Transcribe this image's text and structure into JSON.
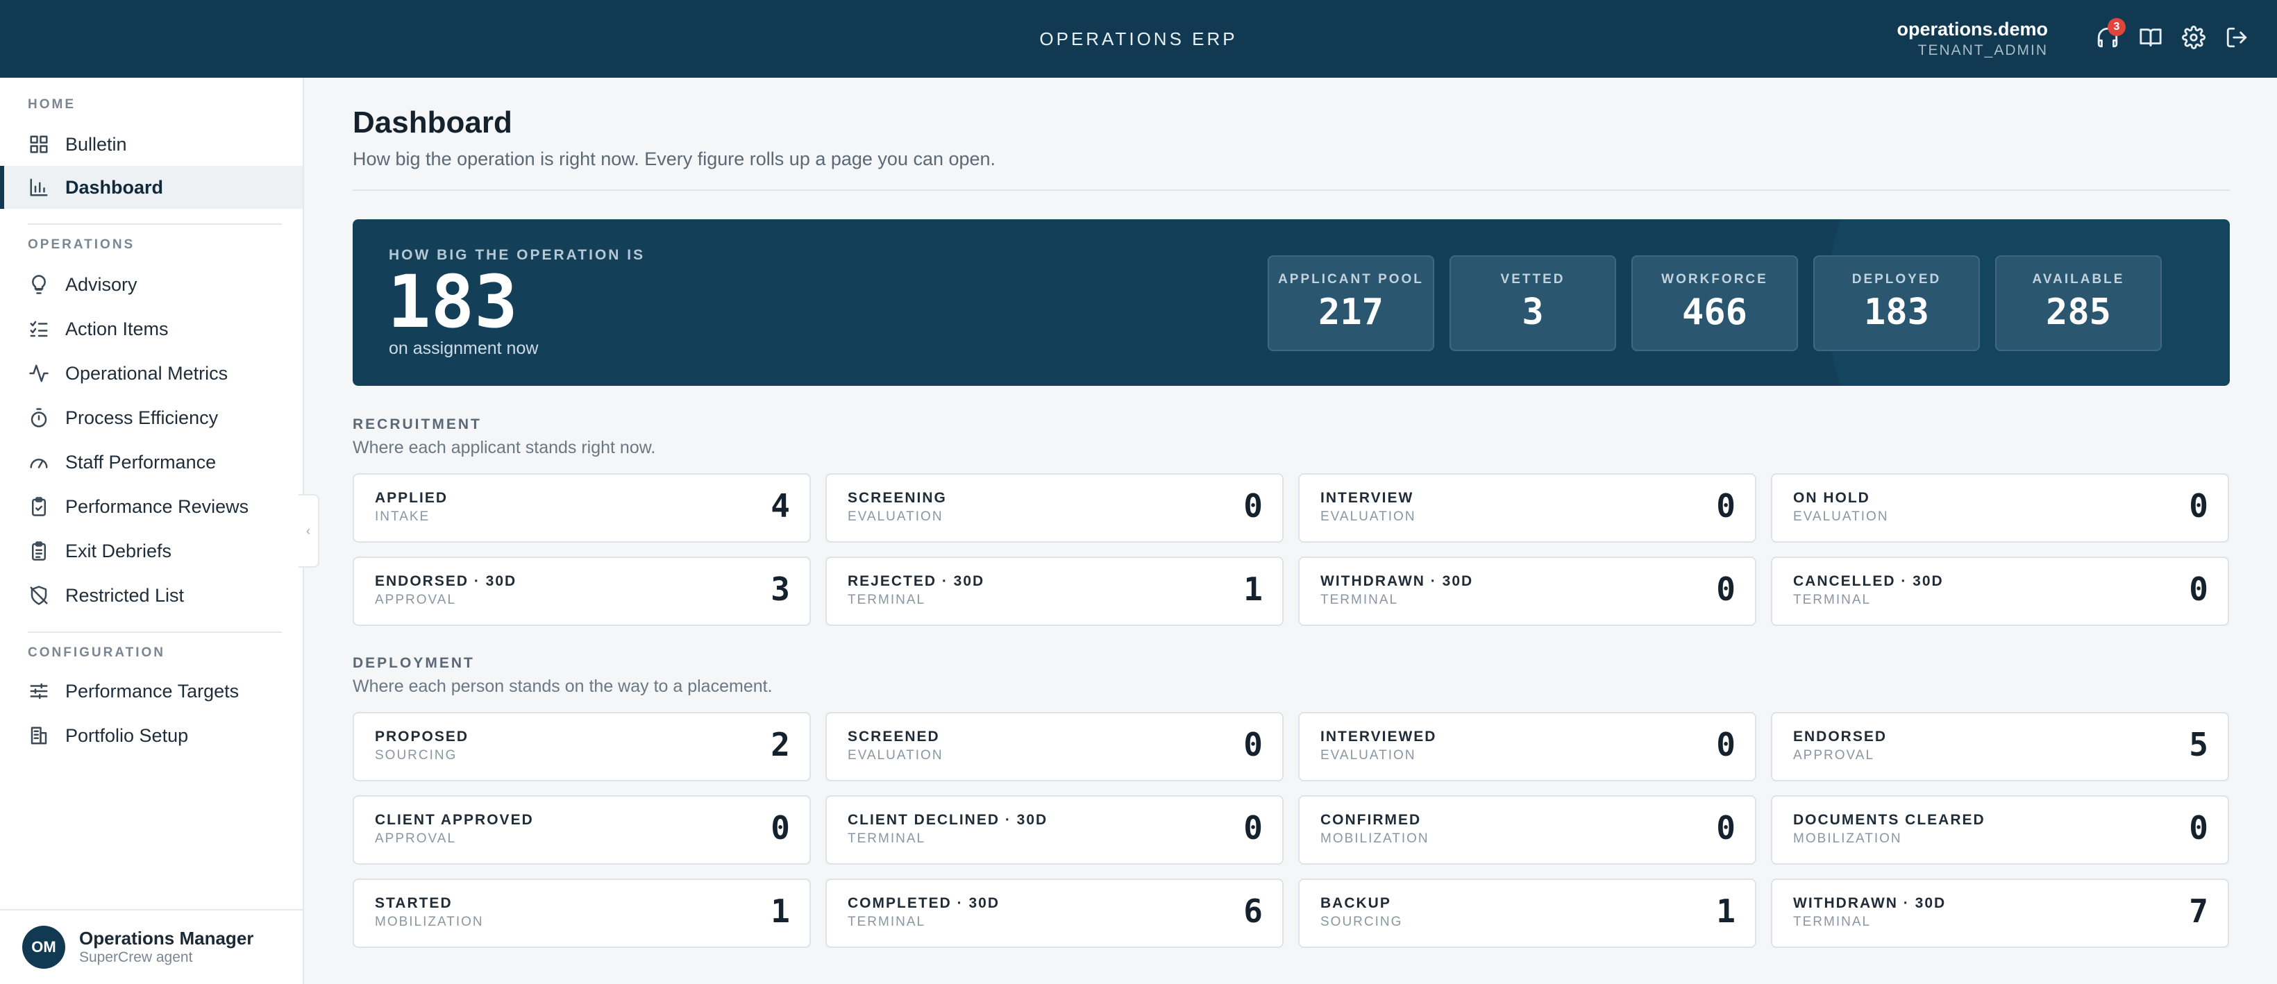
{
  "header": {
    "app_title": "OPERATIONS ERP",
    "user_name": "operations.demo",
    "user_role": "TENANT_ADMIN",
    "notification_count": "3",
    "icons": [
      "headset-icon",
      "book-icon",
      "gear-icon",
      "logout-icon"
    ]
  },
  "sidebar": {
    "sections": {
      "home": "HOME",
      "operations": "OPERATIONS",
      "configuration": "CONFIGURATION"
    },
    "items": {
      "bulletin": "Bulletin",
      "dashboard": "Dashboard",
      "advisory": "Advisory",
      "action_items": "Action Items",
      "operational_metrics": "Operational Metrics",
      "process_efficiency": "Process Efficiency",
      "staff_performance": "Staff Performance",
      "performance_reviews": "Performance Reviews",
      "exit_debriefs": "Exit Debriefs",
      "restricted_list": "Restricted List",
      "performance_targets": "Performance Targets",
      "portfolio_setup": "Portfolio Setup"
    },
    "active": "dashboard",
    "user": {
      "initials": "OM",
      "name": "Operations Manager",
      "subtitle": "SuperCrew agent"
    },
    "collapse_glyph": "‹"
  },
  "main": {
    "title": "Dashboard",
    "subtitle": "How big the operation is right now. Every figure rolls up a page you can open.",
    "hero": {
      "label": "HOW BIG THE OPERATION IS",
      "value": "183",
      "sub": "on assignment now",
      "stats": [
        {
          "label": "APPLICANT POOL",
          "value": "217"
        },
        {
          "label": "VETTED",
          "value": "3"
        },
        {
          "label": "WORKFORCE",
          "value": "466"
        },
        {
          "label": "DEPLOYED",
          "value": "183"
        },
        {
          "label": "AVAILABLE",
          "value": "285"
        }
      ]
    },
    "recruitment": {
      "title": "RECRUITMENT",
      "subtitle": "Where each applicant stands right now.",
      "cards": [
        {
          "label": "APPLIED",
          "sub": "INTAKE",
          "value": "4"
        },
        {
          "label": "SCREENING",
          "sub": "EVALUATION",
          "value": "0"
        },
        {
          "label": "INTERVIEW",
          "sub": "EVALUATION",
          "value": "0"
        },
        {
          "label": "ON HOLD",
          "sub": "EVALUATION",
          "value": "0"
        },
        {
          "label": "ENDORSED · 30D",
          "sub": "APPROVAL",
          "value": "3"
        },
        {
          "label": "REJECTED · 30D",
          "sub": "TERMINAL",
          "value": "1"
        },
        {
          "label": "WITHDRAWN · 30D",
          "sub": "TERMINAL",
          "value": "0"
        },
        {
          "label": "CANCELLED · 30D",
          "sub": "TERMINAL",
          "value": "0"
        }
      ]
    },
    "deployment": {
      "title": "DEPLOYMENT",
      "subtitle": "Where each person stands on the way to a placement.",
      "cards": [
        {
          "label": "PROPOSED",
          "sub": "SOURCING",
          "value": "2"
        },
        {
          "label": "SCREENED",
          "sub": "EVALUATION",
          "value": "0"
        },
        {
          "label": "INTERVIEWED",
          "sub": "EVALUATION",
          "value": "0"
        },
        {
          "label": "ENDORSED",
          "sub": "APPROVAL",
          "value": "5"
        },
        {
          "label": "CLIENT APPROVED",
          "sub": "APPROVAL",
          "value": "0"
        },
        {
          "label": "CLIENT DECLINED · 30D",
          "sub": "TERMINAL",
          "value": "0"
        },
        {
          "label": "CONFIRMED",
          "sub": "MOBILIZATION",
          "value": "0"
        },
        {
          "label": "DOCUMENTS CLEARED",
          "sub": "MOBILIZATION",
          "value": "0"
        },
        {
          "label": "STARTED",
          "sub": "MOBILIZATION",
          "value": "1"
        },
        {
          "label": "COMPLETED · 30D",
          "sub": "TERMINAL",
          "value": "6"
        },
        {
          "label": "BACKUP",
          "sub": "SOURCING",
          "value": "1"
        },
        {
          "label": "WITHDRAWN · 30D",
          "sub": "TERMINAL",
          "value": "7"
        }
      ]
    }
  },
  "colors": {
    "header_bg": "#113a52",
    "hero_bg": "#133f59",
    "notification_badge": "#e0443a",
    "page_bg": "#f4f6f8"
  }
}
